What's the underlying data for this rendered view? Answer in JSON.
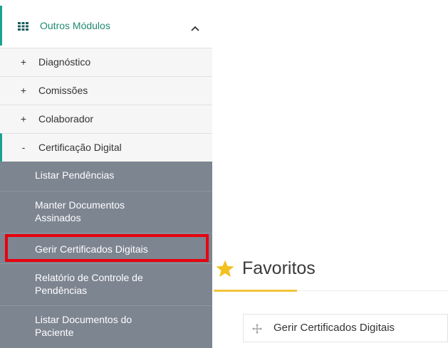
{
  "sidebar": {
    "module": {
      "title": "Outros Módulos",
      "icon": "grid-icon",
      "chevron": "chevron-up-icon",
      "accent_color": "#19a38c"
    },
    "items": [
      {
        "sign": "+",
        "label": "Diagnóstico"
      },
      {
        "sign": "+",
        "label": "Comissões"
      },
      {
        "sign": "+",
        "label": "Colaborador"
      },
      {
        "sign": "-",
        "label": "Certificação Digital"
      }
    ],
    "subitems": [
      {
        "label": "Listar Pendências"
      },
      {
        "label": "Manter Documentos Assinados"
      },
      {
        "label": "Gerir Certificados Digitais"
      },
      {
        "label": "Relatório de Controle de Pendências"
      },
      {
        "label": "Listar Documentos do Paciente"
      }
    ],
    "submenu_color": "#7d8591",
    "highlight_color": "#e8000e"
  },
  "favorites": {
    "title": "Favoritos",
    "icon": "star-icon",
    "star_color": "#f2c11f",
    "items": [
      {
        "label": "Gerir Certificados Digitais",
        "icon": "move-icon"
      }
    ]
  }
}
